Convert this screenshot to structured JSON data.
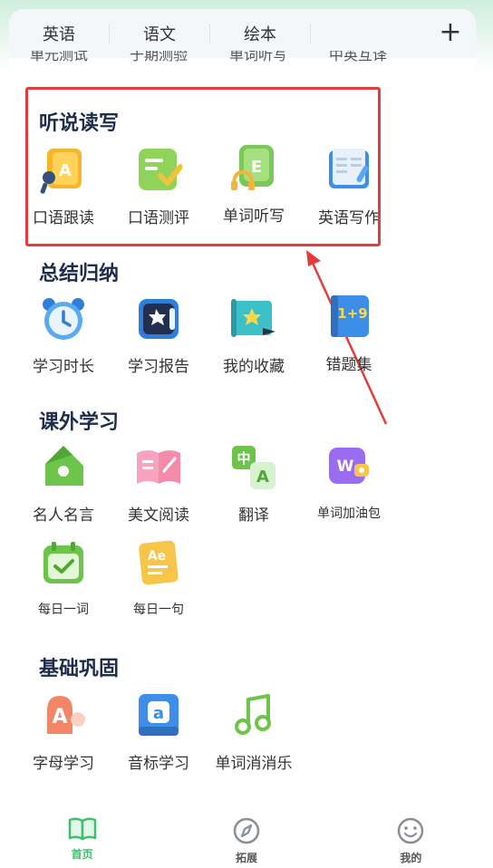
{
  "tabs": [
    "英语",
    "语文",
    "绘本"
  ],
  "peek_row": [
    "单元测试",
    "于期测验",
    "单词听写",
    "中英互译"
  ],
  "sections": {
    "listen": {
      "title": "听说读写",
      "items": [
        "口语跟读",
        "口语测评",
        "单词听写",
        "英语写作"
      ]
    },
    "summary": {
      "title": "总结归纳",
      "items": [
        "学习时长",
        "学习报告",
        "我的收藏",
        "错题集"
      ]
    },
    "extra": {
      "title": "课外学习",
      "items": [
        "名人名言",
        "美文阅读",
        "翻译",
        "单词加油包",
        "每日一词",
        "每日一句"
      ]
    },
    "basic": {
      "title": "基础巩固",
      "items": [
        "字母学习",
        "音标学习",
        "单词消消乐"
      ]
    }
  },
  "icon_text": {
    "oral_read": "A",
    "dictation": "E",
    "translate_zh": "中",
    "translate_en": "A",
    "booster": "W",
    "daily_sentence": "Ae",
    "error_book": "1+9",
    "letters": "A",
    "phonetics": "a"
  },
  "bottom_nav": [
    {
      "label": "首页",
      "icon": "book-icon",
      "active": true
    },
    {
      "label": "拓展",
      "icon": "compass-icon",
      "active": false
    },
    {
      "label": "我的",
      "icon": "smile-icon",
      "active": false
    }
  ],
  "colors": {
    "active": "#3cc06a",
    "inactive": "#8a8f96",
    "highlight": "#e43b3b",
    "title": "#1f2d4d"
  }
}
